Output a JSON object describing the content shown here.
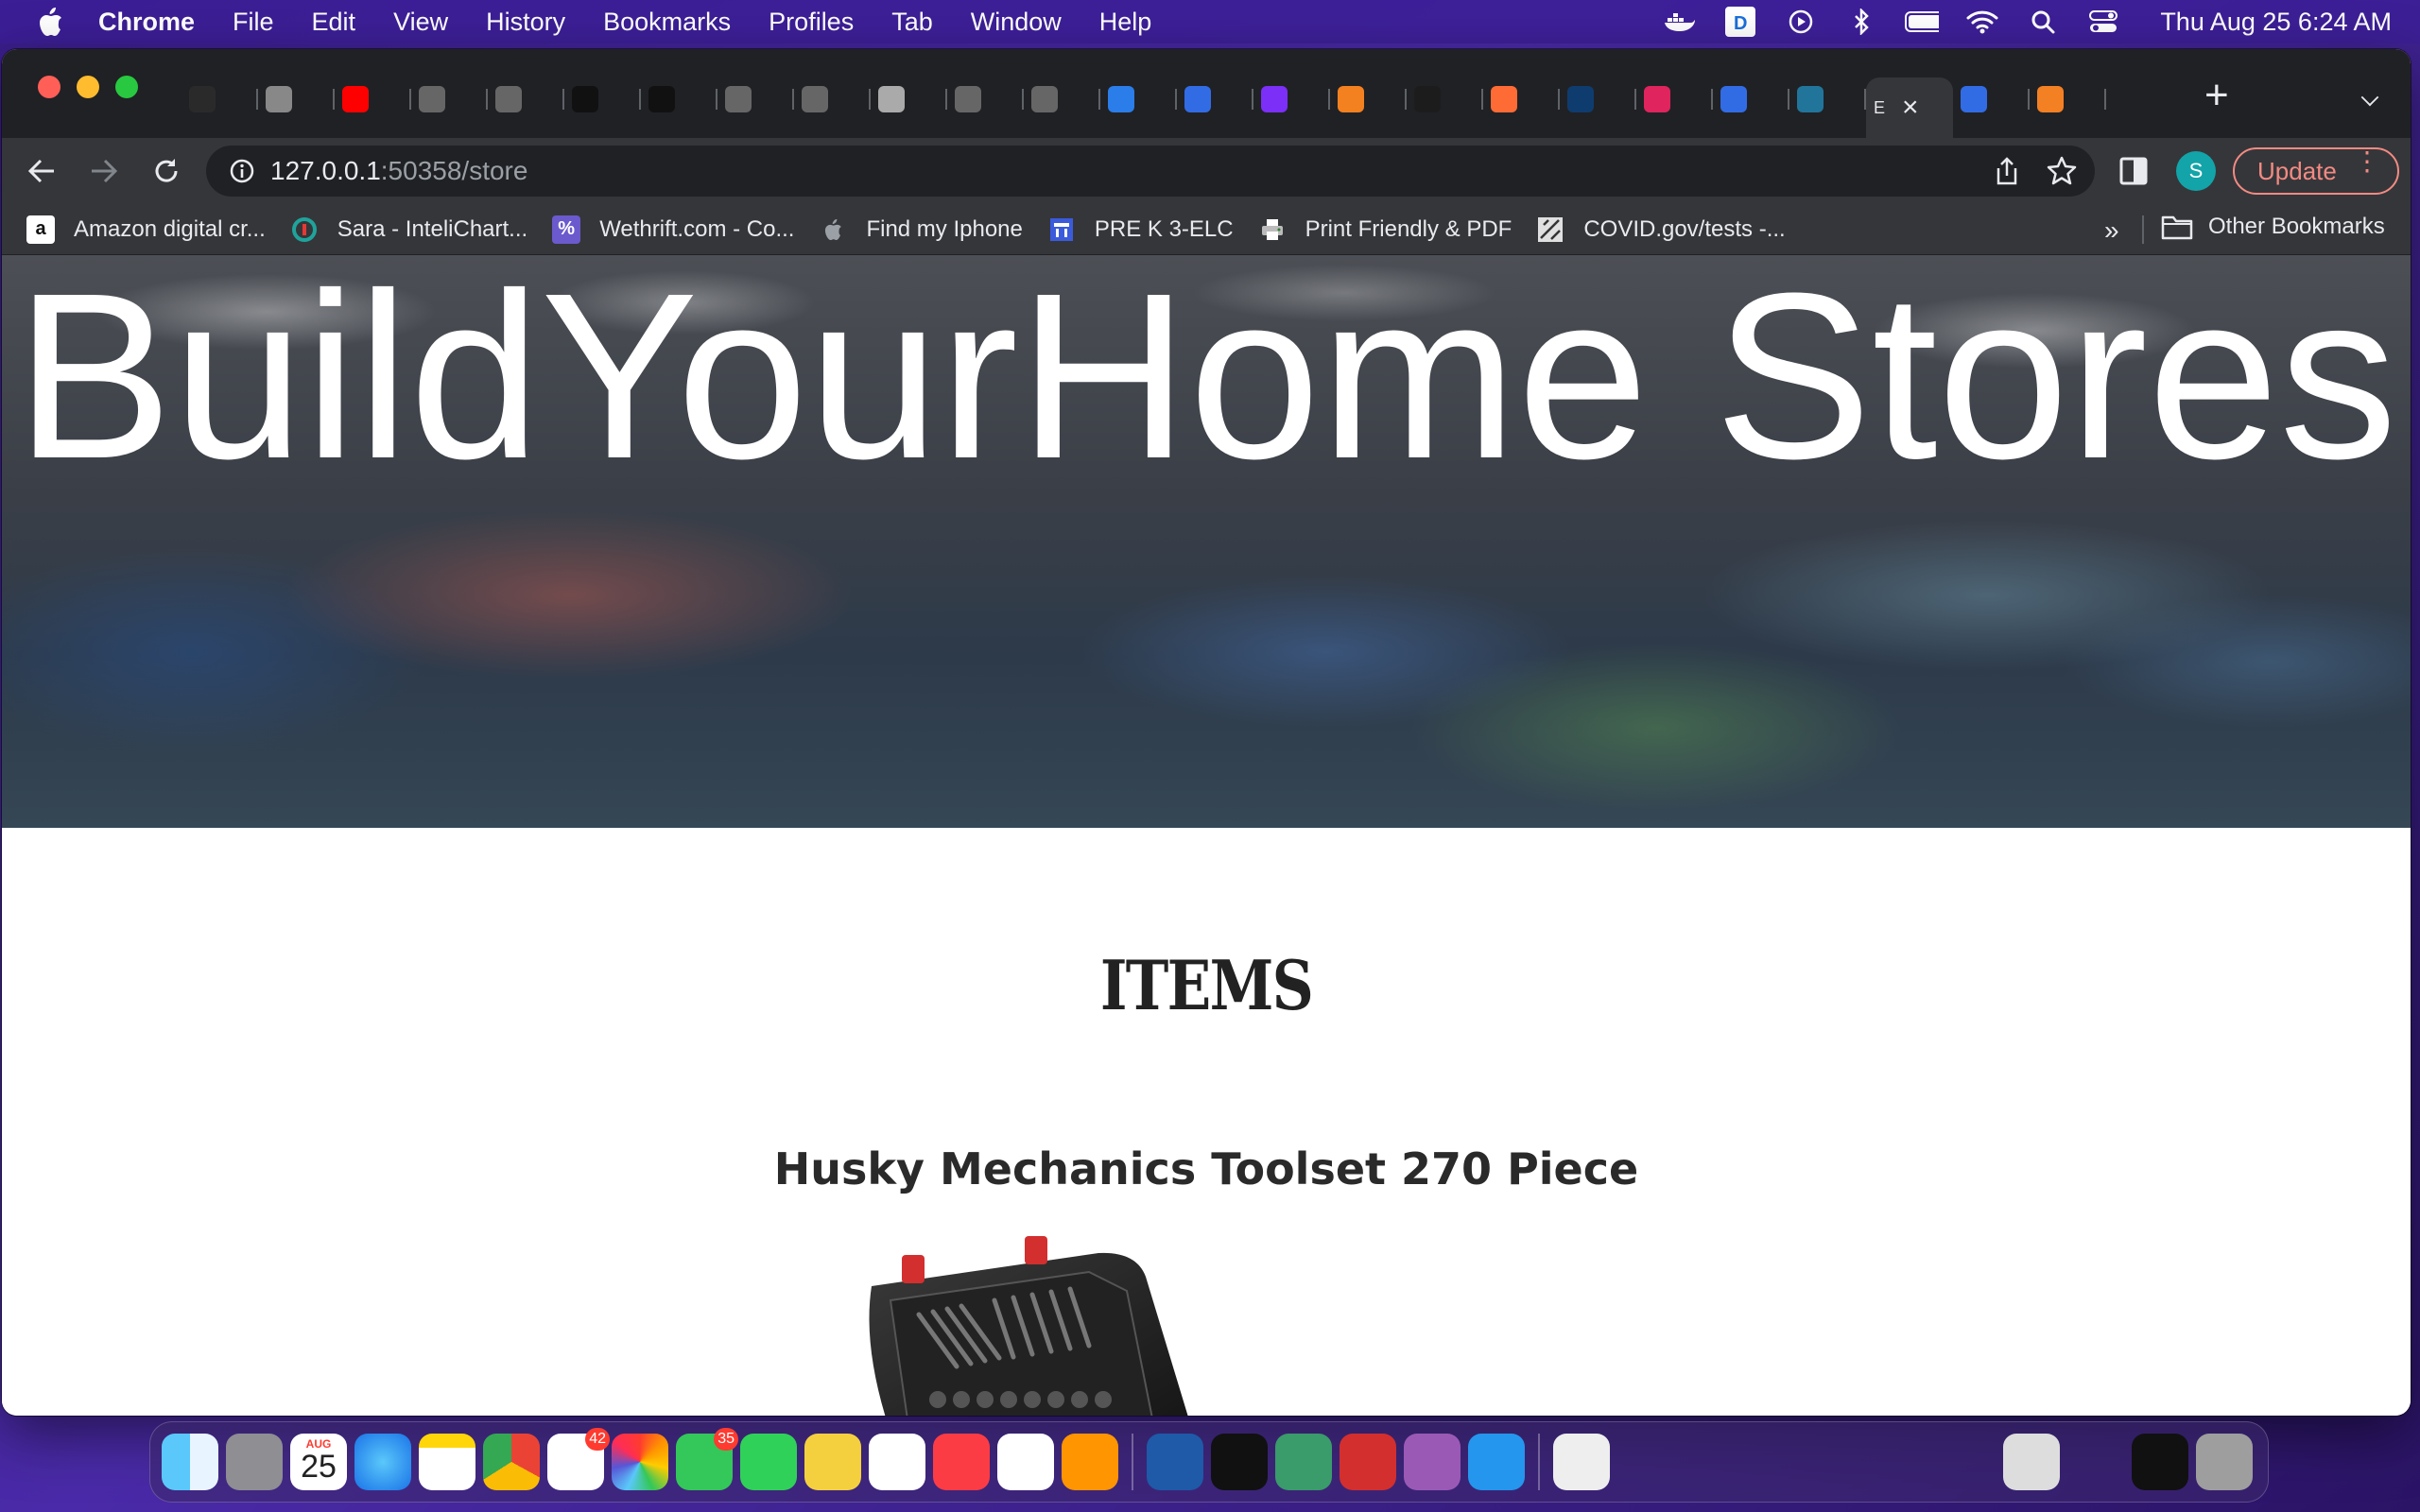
{
  "menubar": {
    "app": "Chrome",
    "items": [
      "File",
      "Edit",
      "View",
      "History",
      "Bookmarks",
      "Profiles",
      "Tab",
      "Window",
      "Help"
    ],
    "clock": "Thu Aug 25  6:24 AM"
  },
  "tabs": {
    "active_label": "E",
    "inactive_label": "",
    "favicon_colors": [
      "#2a2a2a",
      "#888",
      "#ff0000",
      "#666",
      "#666",
      "#111",
      "#111",
      "#666",
      "#666",
      "#aaa",
      "#666",
      "#666",
      "#2b7de9",
      "#326ce5",
      "#7b2ff7",
      "#f48120",
      "#1c1c1c",
      "#ff6b35",
      "#0f3c6e",
      "#e0245e",
      "#326ce5",
      "#21759b",
      "#2b7de9",
      "#326ce5",
      "#f48024"
    ]
  },
  "toolbar": {
    "url_host": "127.0.0.1",
    "url_rest": ":50358/store",
    "avatar_letter": "S",
    "update_label": "Update"
  },
  "bookmarks": {
    "items": [
      {
        "label": "Amazon digital cr...",
        "icon": "amazon-icon",
        "color": "#ffffff"
      },
      {
        "label": "Sara - InteliChart...",
        "icon": "intelichart-icon",
        "color": "#1fa39b"
      },
      {
        "label": "Wethrift.com - Co...",
        "icon": "wethrift-icon",
        "color": "#6a5acd"
      },
      {
        "label": "Find my Iphone",
        "icon": "apple-icon",
        "color": "#9aa0a6"
      },
      {
        "label": "PRE K 3-ELC",
        "icon": "elc-icon",
        "color": "#3b5bdb"
      },
      {
        "label": "Print Friendly & PDF",
        "icon": "printer-icon",
        "color": "#dddddd"
      },
      {
        "label": "COVID.gov/tests -...",
        "icon": "covid-icon",
        "color": "#cccccc"
      }
    ],
    "overflow": "»",
    "other": "Other Bookmarks"
  },
  "page": {
    "hero_title": "BuildYourHome Stores",
    "section_heading": "ITEMS",
    "item_title": "Husky Mechanics Toolset 270 Piece"
  },
  "dock": {
    "calendar_month": "AUG",
    "calendar_day": "25",
    "reminders_badge": "42",
    "messages_badge": "35"
  }
}
